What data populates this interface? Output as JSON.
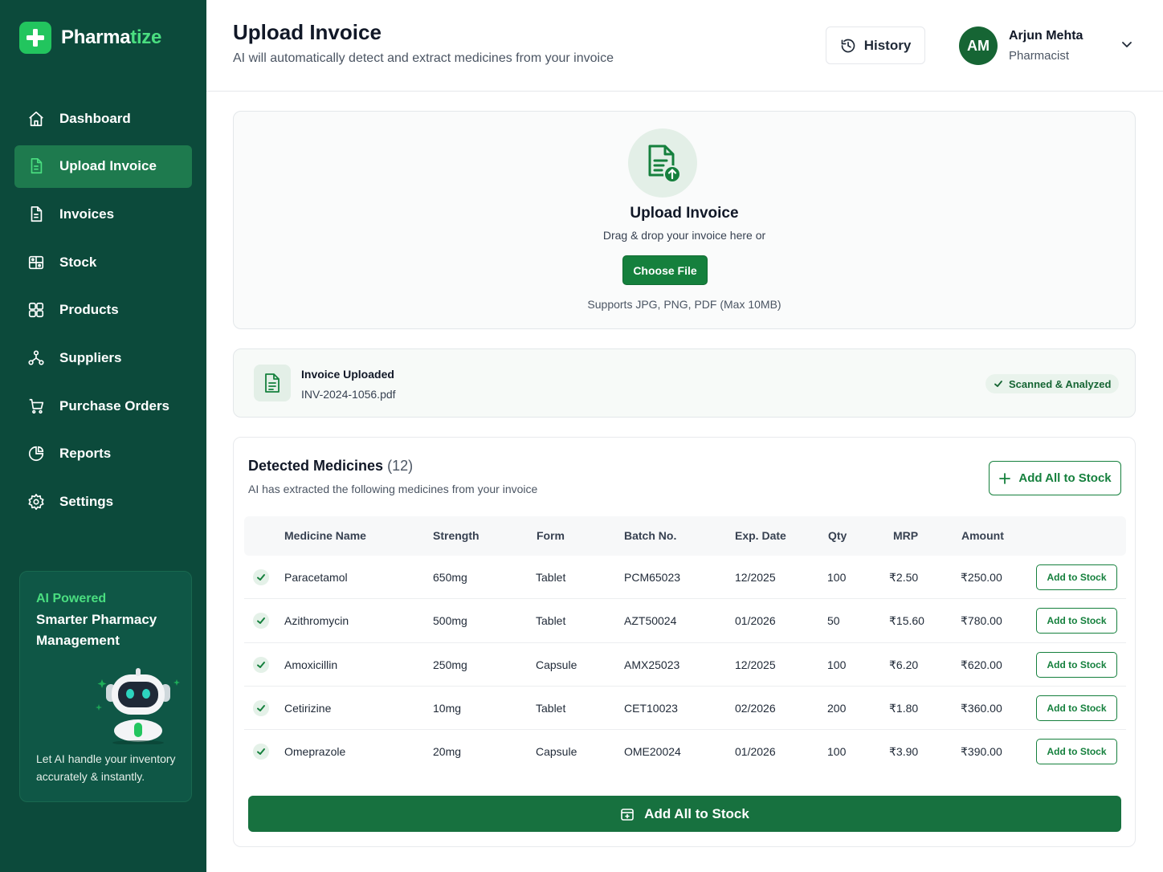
{
  "brand": {
    "name_primary": "Pharma",
    "name_accent": "tize"
  },
  "sidebar": {
    "items": [
      {
        "label": "Dashboard",
        "icon": "home-icon",
        "active": false
      },
      {
        "label": "Upload Invoice",
        "icon": "upload-document-icon",
        "active": true
      },
      {
        "label": "Invoices",
        "icon": "document-icon",
        "active": false
      },
      {
        "label": "Stock",
        "icon": "stock-icon",
        "active": false
      },
      {
        "label": "Products",
        "icon": "products-icon",
        "active": false
      },
      {
        "label": "Suppliers",
        "icon": "suppliers-icon",
        "active": false
      },
      {
        "label": "Purchase Orders",
        "icon": "cart-icon",
        "active": false
      },
      {
        "label": "Reports",
        "icon": "reports-icon",
        "active": false
      },
      {
        "label": "Settings",
        "icon": "gear-icon",
        "active": false
      }
    ],
    "ai_card": {
      "tag": "AI Powered",
      "title": "Smarter Pharmacy Management",
      "description": "Let AI handle your inventory accurately & instantly."
    }
  },
  "header": {
    "title": "Upload Invoice",
    "subtitle": "AI will automatically detect and extract medicines from your invoice",
    "history_label": "History",
    "user": {
      "initials": "AM",
      "name": "Arjun Mehta",
      "role": "Pharmacist"
    }
  },
  "upload": {
    "title": "Upload Invoice",
    "description": "Drag & drop your invoice here or",
    "button_label": "Choose File",
    "note": "Supports JPG, PNG, PDF (Max 10MB)"
  },
  "uploaded_file": {
    "label": "Invoice Uploaded",
    "file_name": "INV-2024-1056.pdf",
    "status": "Scanned & Analyzed"
  },
  "detected": {
    "title": "Detected Medicines",
    "count": "(12)",
    "subtitle": "AI has extracted the following medicines from your invoice",
    "add_all_label": "Add All to Stock",
    "columns": [
      "Medicine Name",
      "Strength",
      "Form",
      "Batch No.",
      "Exp. Date",
      "Qty",
      "MRP",
      "Amount"
    ],
    "row_action_label": "Add to Stock",
    "rows": [
      {
        "name": "Paracetamol",
        "strength": "650mg",
        "form": "Tablet",
        "batch": "PCM65023",
        "exp": "12/2025",
        "qty": "100",
        "mrp": "₹2.50",
        "amount": "₹250.00"
      },
      {
        "name": "Azithromycin",
        "strength": "500mg",
        "form": "Tablet",
        "batch": "AZT50024",
        "exp": "01/2026",
        "qty": "50",
        "mrp": "₹15.60",
        "amount": "₹780.00"
      },
      {
        "name": "Amoxicillin",
        "strength": "250mg",
        "form": "Capsule",
        "batch": "AMX25023",
        "exp": "12/2025",
        "qty": "100",
        "mrp": "₹6.20",
        "amount": "₹620.00"
      },
      {
        "name": "Cetirizine",
        "strength": "10mg",
        "form": "Tablet",
        "batch": "CET10023",
        "exp": "02/2026",
        "qty": "200",
        "mrp": "₹1.80",
        "amount": "₹360.00"
      },
      {
        "name": "Omeprazole",
        "strength": "20mg",
        "form": "Capsule",
        "batch": "OME20024",
        "exp": "01/2026",
        "qty": "100",
        "mrp": "₹3.90",
        "amount": "₹390.00"
      }
    ],
    "bottom_button_label": "Add All to Stock"
  },
  "colors": {
    "sidebar_bg": "#0c4a3b",
    "active_nav": "#1e7a4e",
    "accent_green": "#15803d",
    "brand_accent": "#4ade80"
  }
}
